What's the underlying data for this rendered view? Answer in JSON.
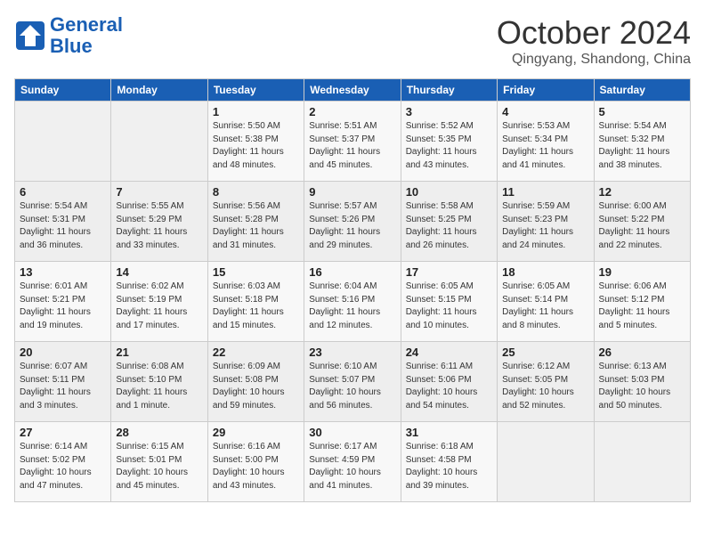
{
  "header": {
    "logo_line1": "General",
    "logo_line2": "Blue",
    "month": "October 2024",
    "location": "Qingyang, Shandong, China"
  },
  "weekdays": [
    "Sunday",
    "Monday",
    "Tuesday",
    "Wednesday",
    "Thursday",
    "Friday",
    "Saturday"
  ],
  "weeks": [
    [
      {
        "day": "",
        "sunrise": "",
        "sunset": "",
        "daylight": ""
      },
      {
        "day": "",
        "sunrise": "",
        "sunset": "",
        "daylight": ""
      },
      {
        "day": "1",
        "sunrise": "Sunrise: 5:50 AM",
        "sunset": "Sunset: 5:38 PM",
        "daylight": "Daylight: 11 hours and 48 minutes."
      },
      {
        "day": "2",
        "sunrise": "Sunrise: 5:51 AM",
        "sunset": "Sunset: 5:37 PM",
        "daylight": "Daylight: 11 hours and 45 minutes."
      },
      {
        "day": "3",
        "sunrise": "Sunrise: 5:52 AM",
        "sunset": "Sunset: 5:35 PM",
        "daylight": "Daylight: 11 hours and 43 minutes."
      },
      {
        "day": "4",
        "sunrise": "Sunrise: 5:53 AM",
        "sunset": "Sunset: 5:34 PM",
        "daylight": "Daylight: 11 hours and 41 minutes."
      },
      {
        "day": "5",
        "sunrise": "Sunrise: 5:54 AM",
        "sunset": "Sunset: 5:32 PM",
        "daylight": "Daylight: 11 hours and 38 minutes."
      }
    ],
    [
      {
        "day": "6",
        "sunrise": "Sunrise: 5:54 AM",
        "sunset": "Sunset: 5:31 PM",
        "daylight": "Daylight: 11 hours and 36 minutes."
      },
      {
        "day": "7",
        "sunrise": "Sunrise: 5:55 AM",
        "sunset": "Sunset: 5:29 PM",
        "daylight": "Daylight: 11 hours and 33 minutes."
      },
      {
        "day": "8",
        "sunrise": "Sunrise: 5:56 AM",
        "sunset": "Sunset: 5:28 PM",
        "daylight": "Daylight: 11 hours and 31 minutes."
      },
      {
        "day": "9",
        "sunrise": "Sunrise: 5:57 AM",
        "sunset": "Sunset: 5:26 PM",
        "daylight": "Daylight: 11 hours and 29 minutes."
      },
      {
        "day": "10",
        "sunrise": "Sunrise: 5:58 AM",
        "sunset": "Sunset: 5:25 PM",
        "daylight": "Daylight: 11 hours and 26 minutes."
      },
      {
        "day": "11",
        "sunrise": "Sunrise: 5:59 AM",
        "sunset": "Sunset: 5:23 PM",
        "daylight": "Daylight: 11 hours and 24 minutes."
      },
      {
        "day": "12",
        "sunrise": "Sunrise: 6:00 AM",
        "sunset": "Sunset: 5:22 PM",
        "daylight": "Daylight: 11 hours and 22 minutes."
      }
    ],
    [
      {
        "day": "13",
        "sunrise": "Sunrise: 6:01 AM",
        "sunset": "Sunset: 5:21 PM",
        "daylight": "Daylight: 11 hours and 19 minutes."
      },
      {
        "day": "14",
        "sunrise": "Sunrise: 6:02 AM",
        "sunset": "Sunset: 5:19 PM",
        "daylight": "Daylight: 11 hours and 17 minutes."
      },
      {
        "day": "15",
        "sunrise": "Sunrise: 6:03 AM",
        "sunset": "Sunset: 5:18 PM",
        "daylight": "Daylight: 11 hours and 15 minutes."
      },
      {
        "day": "16",
        "sunrise": "Sunrise: 6:04 AM",
        "sunset": "Sunset: 5:16 PM",
        "daylight": "Daylight: 11 hours and 12 minutes."
      },
      {
        "day": "17",
        "sunrise": "Sunrise: 6:05 AM",
        "sunset": "Sunset: 5:15 PM",
        "daylight": "Daylight: 11 hours and 10 minutes."
      },
      {
        "day": "18",
        "sunrise": "Sunrise: 6:05 AM",
        "sunset": "Sunset: 5:14 PM",
        "daylight": "Daylight: 11 hours and 8 minutes."
      },
      {
        "day": "19",
        "sunrise": "Sunrise: 6:06 AM",
        "sunset": "Sunset: 5:12 PM",
        "daylight": "Daylight: 11 hours and 5 minutes."
      }
    ],
    [
      {
        "day": "20",
        "sunrise": "Sunrise: 6:07 AM",
        "sunset": "Sunset: 5:11 PM",
        "daylight": "Daylight: 11 hours and 3 minutes."
      },
      {
        "day": "21",
        "sunrise": "Sunrise: 6:08 AM",
        "sunset": "Sunset: 5:10 PM",
        "daylight": "Daylight: 11 hours and 1 minute."
      },
      {
        "day": "22",
        "sunrise": "Sunrise: 6:09 AM",
        "sunset": "Sunset: 5:08 PM",
        "daylight": "Daylight: 10 hours and 59 minutes."
      },
      {
        "day": "23",
        "sunrise": "Sunrise: 6:10 AM",
        "sunset": "Sunset: 5:07 PM",
        "daylight": "Daylight: 10 hours and 56 minutes."
      },
      {
        "day": "24",
        "sunrise": "Sunrise: 6:11 AM",
        "sunset": "Sunset: 5:06 PM",
        "daylight": "Daylight: 10 hours and 54 minutes."
      },
      {
        "day": "25",
        "sunrise": "Sunrise: 6:12 AM",
        "sunset": "Sunset: 5:05 PM",
        "daylight": "Daylight: 10 hours and 52 minutes."
      },
      {
        "day": "26",
        "sunrise": "Sunrise: 6:13 AM",
        "sunset": "Sunset: 5:03 PM",
        "daylight": "Daylight: 10 hours and 50 minutes."
      }
    ],
    [
      {
        "day": "27",
        "sunrise": "Sunrise: 6:14 AM",
        "sunset": "Sunset: 5:02 PM",
        "daylight": "Daylight: 10 hours and 47 minutes."
      },
      {
        "day": "28",
        "sunrise": "Sunrise: 6:15 AM",
        "sunset": "Sunset: 5:01 PM",
        "daylight": "Daylight: 10 hours and 45 minutes."
      },
      {
        "day": "29",
        "sunrise": "Sunrise: 6:16 AM",
        "sunset": "Sunset: 5:00 PM",
        "daylight": "Daylight: 10 hours and 43 minutes."
      },
      {
        "day": "30",
        "sunrise": "Sunrise: 6:17 AM",
        "sunset": "Sunset: 4:59 PM",
        "daylight": "Daylight: 10 hours and 41 minutes."
      },
      {
        "day": "31",
        "sunrise": "Sunrise: 6:18 AM",
        "sunset": "Sunset: 4:58 PM",
        "daylight": "Daylight: 10 hours and 39 minutes."
      },
      {
        "day": "",
        "sunrise": "",
        "sunset": "",
        "daylight": ""
      },
      {
        "day": "",
        "sunrise": "",
        "sunset": "",
        "daylight": ""
      }
    ]
  ]
}
